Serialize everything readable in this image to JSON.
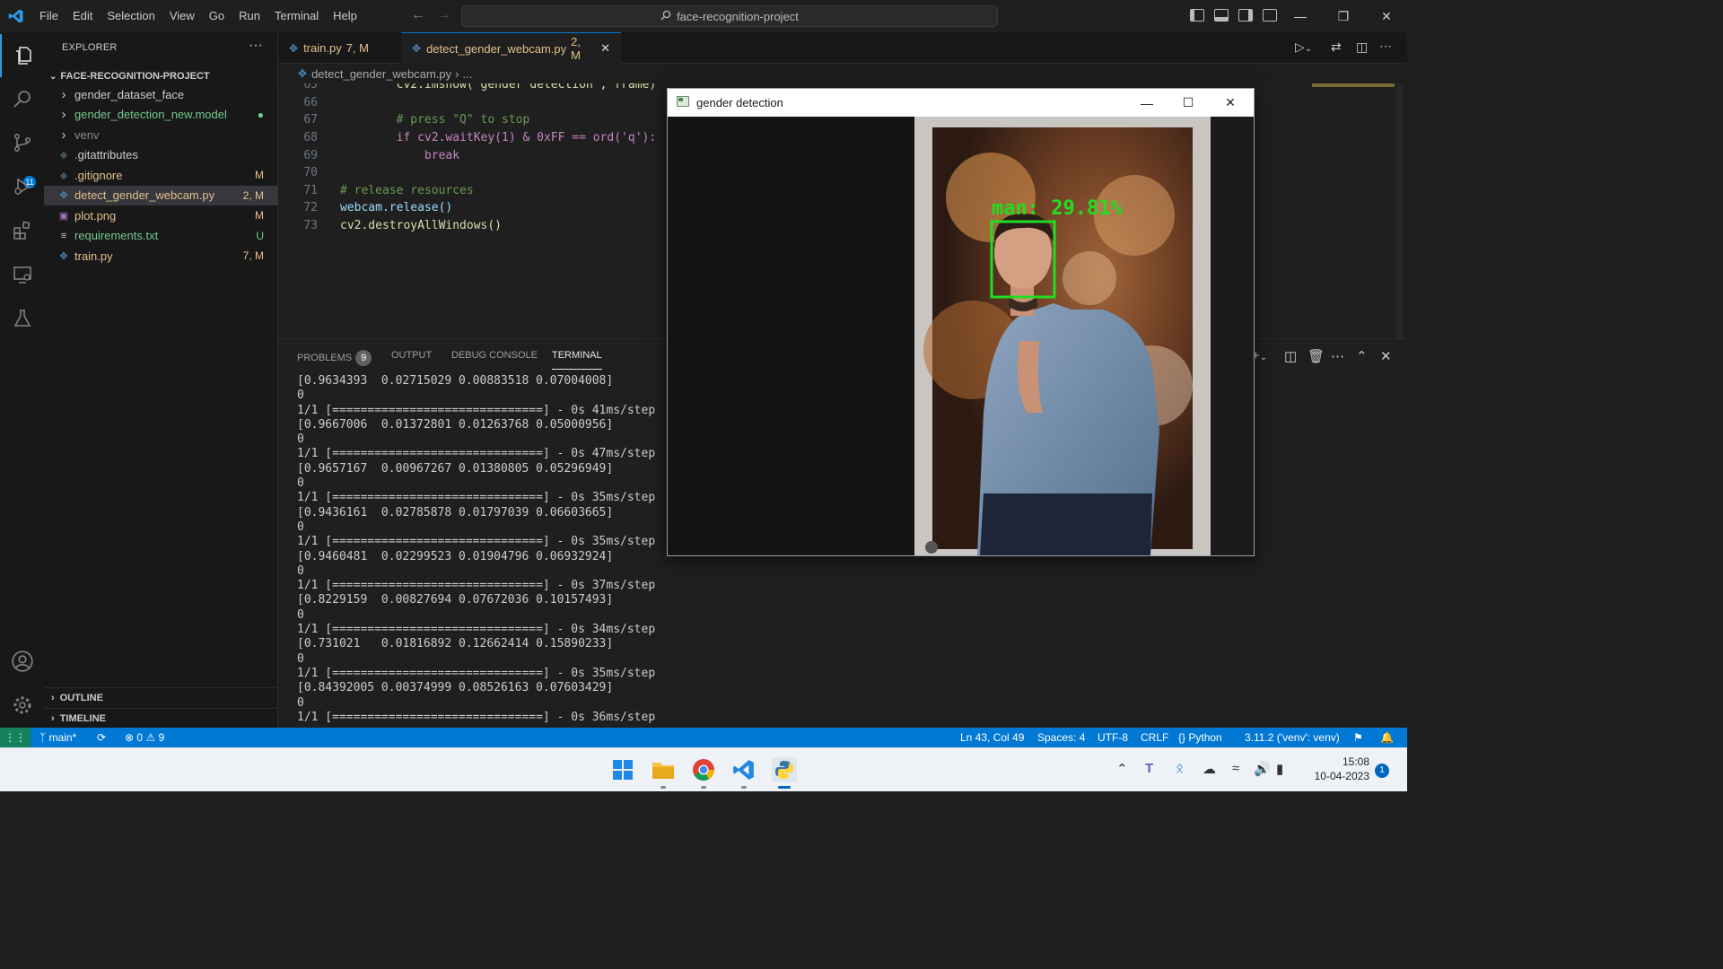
{
  "titlebar": {
    "menu": [
      "File",
      "Edit",
      "Selection",
      "View",
      "Go",
      "Run",
      "Terminal",
      "Help"
    ],
    "search": "face-recognition-project"
  },
  "activity_bar": {
    "items": [
      "explorer-icon",
      "search-icon",
      "source-control-icon",
      "run-debug-icon",
      "extensions-icon",
      "remote-explorer-icon",
      "testing-icon"
    ],
    "scm_badge": "11",
    "bottom": [
      "account-icon",
      "settings-gear-icon"
    ]
  },
  "sidebar": {
    "title": "EXPLORER",
    "more": "···",
    "folder": "FACE-RECOGNITION-PROJECT",
    "items": [
      {
        "label": "gender_dataset_face",
        "kind": "folder",
        "badge": "",
        "color": "#cccccc"
      },
      {
        "label": "gender_detection_new.model",
        "kind": "folder",
        "badge": "●",
        "color": "#73c991"
      },
      {
        "label": "venv",
        "kind": "folder",
        "badge": "",
        "color": "#8c8c8c"
      },
      {
        "label": ".gitattributes",
        "kind": "file",
        "badge": "",
        "color": "#cccccc"
      },
      {
        "label": ".gitignore",
        "kind": "file",
        "badge": "M",
        "color": "#e2c08d"
      },
      {
        "label": "detect_gender_webcam.py",
        "kind": "py",
        "badge": "2, M",
        "color": "#e2c08d"
      },
      {
        "label": "plot.png",
        "kind": "img",
        "badge": "M",
        "color": "#e2c08d"
      },
      {
        "label": "requirements.txt",
        "kind": "txt",
        "badge": "U",
        "color": "#73c991"
      },
      {
        "label": "train.py",
        "kind": "py",
        "badge": "7, M",
        "color": "#e2c08d"
      }
    ],
    "outline": "OUTLINE",
    "timeline": "TIMELINE"
  },
  "tabs": [
    {
      "label": "train.py",
      "status": "7, M",
      "active": false
    },
    {
      "label": "detect_gender_webcam.py",
      "status": "2, M",
      "active": true
    }
  ],
  "breadcrumb": {
    "file": "detect_gender_webcam.py",
    "rest": "..."
  },
  "editor": {
    "lines": [
      {
        "num": "65",
        "text": "        cv2.imshow(\"gender detection\", frame)"
      },
      {
        "num": "66",
        "text": ""
      },
      {
        "num": "67",
        "text": "        # press \"Q\" to stop"
      },
      {
        "num": "68",
        "text": "        if cv2.waitKey(1) & 0xFF == ord('q'):"
      },
      {
        "num": "69",
        "text": "            break"
      },
      {
        "num": "70",
        "text": ""
      },
      {
        "num": "71",
        "text": "# release resources"
      },
      {
        "num": "72",
        "text": "webcam.release()"
      },
      {
        "num": "73",
        "text": "cv2.destroyAllWindows()"
      }
    ]
  },
  "panel": {
    "tabs": [
      "PROBLEMS",
      "OUTPUT",
      "DEBUG CONSOLE",
      "TERMINAL"
    ],
    "problems_count": "9",
    "terminal_lines": [
      "[0.9634393  0.02715029 0.00883518 0.07004008]",
      "0",
      "1/1 [==============================] - 0s 41ms/step",
      "[0.9667006  0.01372801 0.01263768 0.05000956]",
      "0",
      "1/1 [==============================] - 0s 47ms/step",
      "[0.9657167  0.00967267 0.01380805 0.05296949]",
      "0",
      "1/1 [==============================] - 0s 35ms/step",
      "[0.9436161  0.02785878 0.01797039 0.06603665]",
      "0",
      "1/1 [==============================] - 0s 35ms/step",
      "[0.9460481  0.02299523 0.01904796 0.06932924]",
      "0",
      "1/1 [==============================] - 0s 37ms/step",
      "[0.8229159  0.00827694 0.07672036 0.10157493]",
      "0",
      "1/1 [==============================] - 0s 34ms/step",
      "[0.731021   0.01816892 0.12662414 0.15890233]",
      "0",
      "1/1 [==============================] - 0s 35ms/step",
      "[0.84392005 0.00374999 0.08526163 0.07603429]",
      "0",
      "1/1 [==============================] - 0s 36ms/step"
    ]
  },
  "statusbar": {
    "branch": "main*",
    "errors": "0",
    "warnings": "9",
    "position": "Ln 43, Col 49",
    "spaces": "Spaces: 4",
    "encoding": "UTF-8",
    "eol": "CRLF",
    "language": "Python",
    "interpreter": "3.11.2 ('venv': venv)"
  },
  "gender_window": {
    "title": "gender detection",
    "label": "man: 29.81%",
    "label_color": "#22dd22"
  },
  "taskbar": {
    "apps": [
      "windows-start-icon",
      "file-explorer-icon",
      "chrome-icon",
      "vscode-icon",
      "python-icon"
    ],
    "time": "15:08",
    "date": "10-04-2023",
    "notification_count": "1"
  },
  "colors": {
    "accent": "#0078d4",
    "modified": "#e2c08d",
    "untracked": "#73c991"
  }
}
